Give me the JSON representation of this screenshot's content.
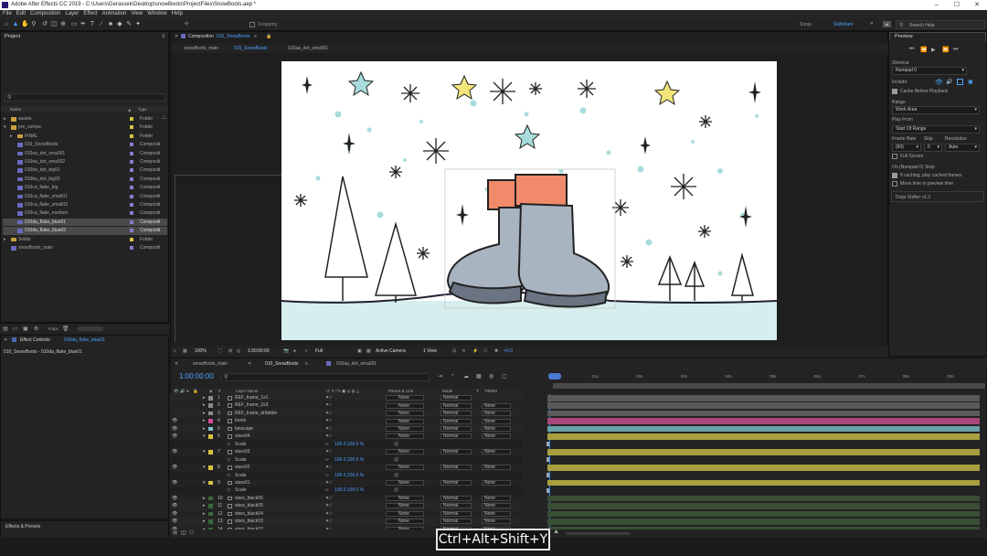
{
  "title": "Adobe After Effects CC 2019 - C:\\Users\\Gerassek\\Desktop\\snowBoots\\ProjectFiles\\SnowBoots.aep *",
  "menu": [
    "File",
    "Edit",
    "Composition",
    "Layer",
    "Effect",
    "Animation",
    "View",
    "Window",
    "Help"
  ],
  "toolbar": {
    "snapping": "Snapping",
    "workspace_user": "Sonja",
    "workspace_skillshare": "Skillshare",
    "search_help": "Search Help"
  },
  "project": {
    "title": "Project",
    "col_name": "Name",
    "col_type": "Type",
    "items": [
      {
        "name": "assets",
        "type": "Folder",
        "color": "#d4c440",
        "kind": "folder",
        "arrow": "▸",
        "indent": 0
      },
      {
        "name": "pre_comps",
        "type": "Folder",
        "color": "#d4c440",
        "kind": "folder",
        "arrow": "▾",
        "indent": 0
      },
      {
        "name": "FINAL",
        "type": "Folder",
        "color": "#d4c440",
        "kind": "folder",
        "arrow": "▸",
        "indent": 1
      },
      {
        "name": "010_SnowBoots",
        "type": "Compositi",
        "color": "#8a7ad0",
        "kind": "comp",
        "arrow": "",
        "indent": 1
      },
      {
        "name": "010ea_dot_sma001",
        "type": "Compositi",
        "color": "#8a7ad0",
        "kind": "comp",
        "arrow": "",
        "indent": 1
      },
      {
        "name": "010ea_dot_sma002",
        "type": "Compositi",
        "color": "#8a7ad0",
        "kind": "comp",
        "arrow": "",
        "indent": 1
      },
      {
        "name": "010ba_dot_big01",
        "type": "Compositi",
        "color": "#8a7ad0",
        "kind": "comp",
        "arrow": "",
        "indent": 1
      },
      {
        "name": "010ba_dot_big02",
        "type": "Compositi",
        "color": "#8a7ad0",
        "kind": "comp",
        "arrow": "",
        "indent": 1
      },
      {
        "name": "010ca_flake_big",
        "type": "Compositi",
        "color": "#8a7ad0",
        "kind": "comp",
        "arrow": "",
        "indent": 1
      },
      {
        "name": "010ca_flake_small01",
        "type": "Compositi",
        "color": "#8a7ad0",
        "kind": "comp",
        "arrow": "",
        "indent": 1
      },
      {
        "name": "010ca_flake_small02",
        "type": "Compositi",
        "color": "#8a7ad0",
        "kind": "comp",
        "arrow": "",
        "indent": 1
      },
      {
        "name": "010ca_flake_medium",
        "type": "Compositi",
        "color": "#8a7ad0",
        "kind": "comp",
        "arrow": "",
        "indent": 1
      },
      {
        "name": "010da_flake_blue01",
        "type": "Compositi",
        "color": "#8a7ad0",
        "kind": "comp",
        "arrow": "",
        "indent": 1,
        "selected": true
      },
      {
        "name": "010da_flake_blue02",
        "type": "Compositi",
        "color": "#8a7ad0",
        "kind": "comp",
        "arrow": "",
        "indent": 1,
        "selected": true
      },
      {
        "name": "Solids",
        "type": "Folder",
        "color": "#d4c440",
        "kind": "folder",
        "arrow": "▸",
        "indent": 0
      },
      {
        "name": "snowBoots_main",
        "type": "Compositi",
        "color": "#8a7ad0",
        "kind": "comp",
        "arrow": "",
        "indent": 0
      }
    ],
    "bpc": "8 bpc"
  },
  "effect_controls": {
    "tab": "Effect Controls",
    "layer": "010da_flake_blue01",
    "breadcrumb": "010_SnowBoots - 010da_flake_blue01"
  },
  "effects_presets": "Effects & Presets",
  "composition": {
    "header_label": "Composition",
    "header_name": "010_SnowBoots",
    "tabs": [
      "snowBoots_main",
      "010_SnowBoots",
      "010aa_dot_sma001"
    ],
    "zoom": "100%",
    "timecode": "1:00:00:00",
    "resolution": "Full",
    "camera": "Active Camera",
    "views": "1 View",
    "exposure": "+0.0"
  },
  "preview": {
    "title": "Preview",
    "shortcut_label": "Shortcut",
    "shortcut_value": "Numpad 0",
    "include_label": "Include:",
    "cache_before_playback": "Cache Before Playback",
    "range_label": "Range",
    "range_value": "Work Area",
    "play_from_label": "Play From",
    "play_from_value": "Start Of Range",
    "frame_rate_label": "Frame Rate",
    "skip_label": "Skip",
    "resolution_label": "Resolution",
    "frame_rate_value": "(60)",
    "skip_value": "0",
    "resolution_value": "Auto",
    "full_screen": "Full Screen",
    "on_stop": "On (Numpad 0) Stop:",
    "if_caching": "If caching, play cached frames",
    "move_time": "Move time to preview time",
    "extension": "Duijo Shifter v1.3"
  },
  "timeline": {
    "tabs": [
      "snowBoots_main",
      "010_SnowBoots",
      "010aa_dot_sma001"
    ],
    "timecode": "1:00:00:00",
    "headers": {
      "layer_name": "Layer Name",
      "parent": "Parent & Link",
      "mode": "Mode",
      "t": "T",
      "trkmat": "TrkMat"
    },
    "ruler": [
      "01s",
      "02s",
      "03s",
      "04s",
      "05s",
      "06s",
      "07s",
      "08s",
      "09s"
    ],
    "rows": [
      {
        "kind": "layer",
        "num": "1",
        "name": "REF_frame_1x1",
        "color": "#8a8a8a",
        "parent": "None",
        "mode": "Normal",
        "trk": "",
        "eye": false,
        "arrow": "▸",
        "bar": "#5a5a5a"
      },
      {
        "kind": "layer",
        "num": "2",
        "name": "REF_frame_2x3",
        "color": "#8a8a8a",
        "parent": "None",
        "mode": "Normal",
        "trk": "None",
        "eye": false,
        "arrow": "▸",
        "bar": "#5a5a5a"
      },
      {
        "kind": "layer",
        "num": "3",
        "name": "REF_frame_dribbble",
        "color": "#8a8a8a",
        "parent": "None",
        "mode": "Normal",
        "trk": "None",
        "eye": false,
        "arrow": "▸",
        "bar": "#5a5a5a"
      },
      {
        "kind": "layer",
        "num": "4",
        "name": "boots",
        "color": "#d04a9c",
        "parent": "None",
        "mode": "Normal",
        "trk": "None",
        "eye": true,
        "arrow": "▸",
        "bar": "#a8477c"
      },
      {
        "kind": "layer",
        "num": "5",
        "name": "lanscape",
        "color": "#7ec3d0",
        "parent": "None",
        "mode": "Normal",
        "trk": "None",
        "eye": true,
        "arrow": "▸",
        "bar": "#6aa0a8"
      },
      {
        "kind": "layer",
        "num": "6",
        "name": "stars04",
        "color": "#d6c640",
        "parent": "None",
        "mode": "Normal",
        "trk": "None",
        "eye": true,
        "arrow": "▾",
        "bar": "#a8a040"
      },
      {
        "kind": "prop",
        "name": "Scale",
        "value": "100.0,100.0 %"
      },
      {
        "kind": "layer",
        "num": "7",
        "name": "stars03",
        "color": "#d6c640",
        "parent": "None",
        "mode": "Normal",
        "trk": "None",
        "eye": true,
        "arrow": "▾",
        "bar": "#a8a040"
      },
      {
        "kind": "prop",
        "name": "Scale",
        "value": "100.0,100.0 %"
      },
      {
        "kind": "layer",
        "num": "8",
        "name": "stars02",
        "color": "#d6c640",
        "parent": "None",
        "mode": "Normal",
        "trk": "None",
        "eye": true,
        "arrow": "▾",
        "bar": "#a8a040"
      },
      {
        "kind": "prop",
        "name": "Scale",
        "value": "100.0,100.0 %"
      },
      {
        "kind": "layer",
        "num": "9",
        "name": "stars01",
        "color": "#d6c640",
        "parent": "None",
        "mode": "Normal",
        "trk": "None",
        "eye": true,
        "arrow": "▾",
        "bar": "#a8a040"
      },
      {
        "kind": "prop",
        "name": "Scale",
        "value": "100.0,100.0 %"
      },
      {
        "kind": "layer",
        "num": "10",
        "name": "stars_black06",
        "color": "#3a6a3a",
        "parent": "None",
        "mode": "Normal",
        "trk": "None",
        "eye": true,
        "arrow": "▸",
        "bar": "#3a4e36"
      },
      {
        "kind": "layer",
        "num": "11",
        "name": "stars_black05",
        "color": "#3a6a3a",
        "parent": "None",
        "mode": "Normal",
        "trk": "None",
        "eye": true,
        "arrow": "▸",
        "bar": "#3a4e36"
      },
      {
        "kind": "layer",
        "num": "12",
        "name": "stars_black04",
        "color": "#3a6a3a",
        "parent": "None",
        "mode": "Normal",
        "trk": "None",
        "eye": true,
        "arrow": "▸",
        "bar": "#3a4e36"
      },
      {
        "kind": "layer",
        "num": "13",
        "name": "stars_black03",
        "color": "#3a6a3a",
        "parent": "None",
        "mode": "Normal",
        "trk": "None",
        "eye": true,
        "arrow": "▸",
        "bar": "#3a4e36"
      },
      {
        "kind": "layer",
        "num": "14",
        "name": "stars_black02",
        "color": "#3a6a3a",
        "parent": "None",
        "mode": "Normal",
        "trk": "None",
        "eye": true,
        "arrow": "▸",
        "bar": "#3a4e36"
      }
    ],
    "toggle": "Toggle Switches / Modes"
  },
  "shortcut_overlay": "Ctrl+Alt+Shift+Y",
  "colors": {
    "accent": "#2d8ceb",
    "timecode": "#4aa3ff",
    "canvas_bg": "#ffffff",
    "snow_ground": "#d6eeee"
  }
}
